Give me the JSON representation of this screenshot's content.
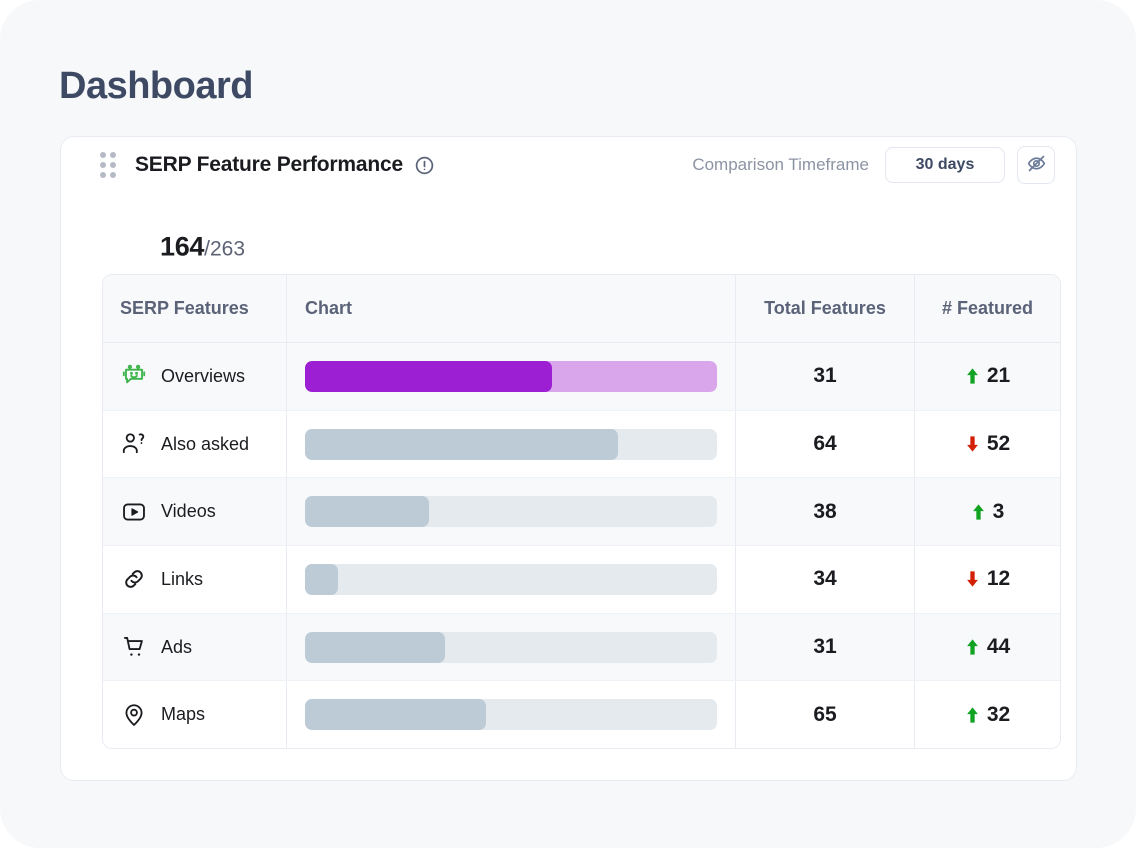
{
  "page": {
    "title": "Dashboard",
    "background": "#f7f8fa"
  },
  "widget": {
    "drag_handle_icon": "drag-dots-icon",
    "title": "SERP Feature Performance",
    "info_icon": "alert-circle-icon",
    "comparison_label": "Comparison Timeframe",
    "timeframe_value": "30 days",
    "visibility_icon": "eye-off-icon",
    "score_primary": "164",
    "score_secondary": "/263"
  },
  "table": {
    "columns": [
      "SERP Features",
      "Chart",
      "Total Features",
      "# Featured"
    ],
    "rows": [
      {
        "icon": "ai-robot-icon",
        "feature": "Overviews",
        "bar_primary_pct": 60,
        "bar_secondary_pct": 100,
        "bar_primary_color": "#9d1fd4",
        "bar_secondary_color": "#d9a6ec",
        "total_features": "31",
        "featured": "21",
        "trend": "up",
        "trend_color": "#11a321"
      },
      {
        "icon": "person-question-icon",
        "feature": "Also asked",
        "bar_primary_pct": 76,
        "bar_secondary_pct": 0,
        "bar_primary_color": "#bdcbd6",
        "bar_secondary_color": "#e5eaef",
        "total_features": "64",
        "featured": "52",
        "trend": "down",
        "trend_color": "#d32005"
      },
      {
        "icon": "video-play-icon",
        "feature": "Videos",
        "bar_primary_pct": 30,
        "bar_secondary_pct": 0,
        "bar_primary_color": "#bdcbd6",
        "bar_secondary_color": "#e5eaef",
        "total_features": "38",
        "featured": "3",
        "trend": "up",
        "trend_color": "#11a321"
      },
      {
        "icon": "link-chain-icon",
        "feature": "Links",
        "bar_primary_pct": 8,
        "bar_secondary_pct": 0,
        "bar_primary_color": "#bdcbd6",
        "bar_secondary_color": "#e5eaef",
        "total_features": "34",
        "featured": "12",
        "trend": "down",
        "trend_color": "#d32005"
      },
      {
        "icon": "shopping-cart-icon",
        "feature": "Ads",
        "bar_primary_pct": 34,
        "bar_secondary_pct": 0,
        "bar_primary_color": "#bdcbd6",
        "bar_secondary_color": "#e5eaef",
        "total_features": "31",
        "featured": "44",
        "trend": "up",
        "trend_color": "#11a321"
      },
      {
        "icon": "map-pin-icon",
        "feature": "Maps",
        "bar_primary_pct": 44,
        "bar_secondary_pct": 0,
        "bar_primary_color": "#bdcbd6",
        "bar_secondary_color": "#e5eaef",
        "total_features": "65",
        "featured": "32",
        "trend": "up",
        "trend_color": "#11a321"
      }
    ]
  },
  "chart_data": {
    "type": "bar",
    "title": "SERP Feature Performance",
    "orientation": "horizontal",
    "categories": [
      "Overviews",
      "Also asked",
      "Videos",
      "Links",
      "Ads",
      "Maps"
    ],
    "series": [
      {
        "name": "Chart fill (% of track)",
        "values": [
          60,
          76,
          30,
          8,
          34,
          44
        ]
      },
      {
        "name": "Total Features",
        "values": [
          31,
          64,
          38,
          34,
          31,
          65
        ]
      },
      {
        "name": "# Featured",
        "values": [
          21,
          52,
          3,
          12,
          44,
          32
        ]
      }
    ],
    "trends": [
      "up",
      "down",
      "up",
      "down",
      "up",
      "up"
    ],
    "summary_value": 164,
    "summary_total": 263,
    "xlabel": "",
    "ylabel": "",
    "grid": false,
    "legend": "none"
  }
}
